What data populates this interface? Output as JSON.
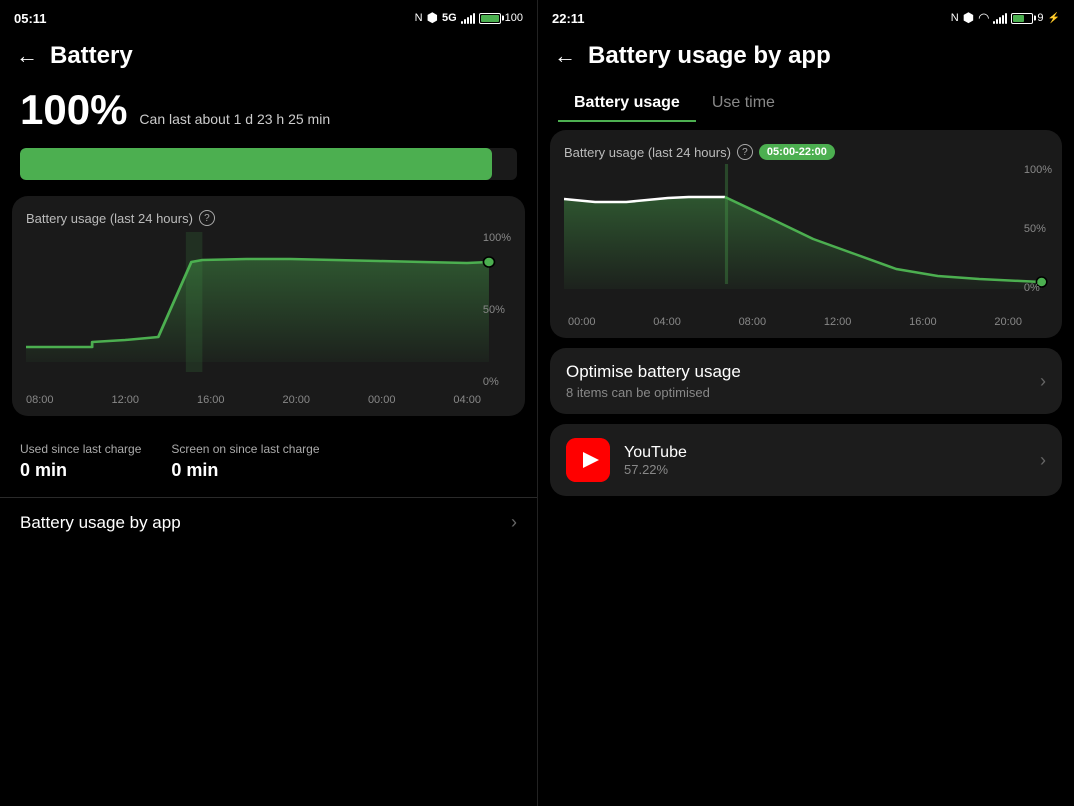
{
  "left": {
    "status": {
      "time": "05:11",
      "icons": [
        "NFC",
        "BT",
        "5G",
        "signal",
        "battery100"
      ]
    },
    "header": {
      "back_label": "←",
      "title": "Battery"
    },
    "battery_pct": "100%",
    "battery_desc": "Can last about 1 d 23 h 25 min",
    "chart_title": "Battery usage (last 24 hours)",
    "chart_x_labels": [
      "08:00",
      "12:00",
      "16:00",
      "20:00",
      "00:00",
      "04:00"
    ],
    "chart_y_labels": [
      "100%",
      "50%",
      "0%"
    ],
    "usage_stats": [
      {
        "label": "Used since last charge",
        "value": "0 min"
      },
      {
        "label": "Screen on since last charge",
        "value": "0 min"
      }
    ],
    "battery_by_app_label": "Battery usage by app"
  },
  "right": {
    "status": {
      "time": "22:11",
      "icons": [
        "NFC",
        "BT",
        "wifi",
        "signal",
        "battery9",
        "charging"
      ]
    },
    "header": {
      "back_label": "←",
      "title": "Battery usage by app"
    },
    "tabs": [
      {
        "label": "Battery usage",
        "active": true
      },
      {
        "label": "Use time",
        "active": false
      }
    ],
    "chart_title": "Battery usage (last 24 hours)",
    "chart_time_badge": "05:00-22:00",
    "chart_x_labels": [
      "00:00",
      "04:00",
      "08:00",
      "12:00",
      "16:00",
      "20:00"
    ],
    "chart_y_labels": [
      "100%",
      "50%",
      "0%"
    ],
    "optimise": {
      "title": "Optimise battery usage",
      "subtitle": "8 items can be optimised"
    },
    "apps": [
      {
        "name": "YouTube",
        "pct": "57.22%",
        "icon_type": "youtube"
      }
    ]
  }
}
